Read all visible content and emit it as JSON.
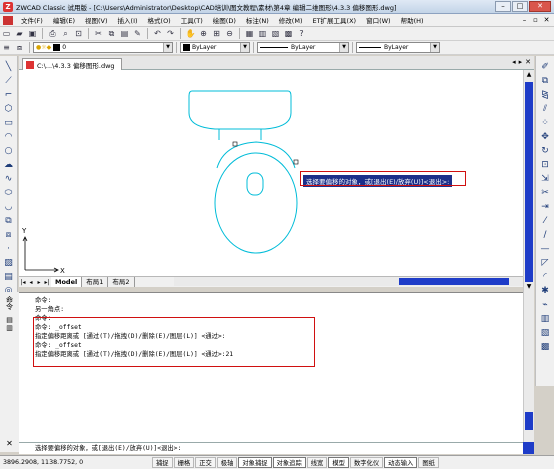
{
  "window": {
    "title": "ZWCAD Classic 试用版 - [C:\\Users\\Administrator\\Desktop\\CAD培训\\图文教程\\素材\\第4章 编辑二维图形\\4.3.3 偏移图形.dwg]",
    "app_icon_letter": "Z",
    "minimize": "–",
    "maximize": "□",
    "close": "✕"
  },
  "menu": {
    "items": [
      "文件(F)",
      "编辑(E)",
      "视图(V)",
      "插入(I)",
      "格式(O)",
      "工具(T)",
      "绘图(D)",
      "标注(N)",
      "修改(M)",
      "ET扩展工具(X)",
      "窗口(W)",
      "帮助(H)"
    ],
    "mdi_min": "–",
    "mdi_restore": "▫",
    "mdi_close": "✕"
  },
  "toolbar2": {
    "layer_value": "0",
    "color_value": "ByLayer",
    "linetype_value": "ByLayer",
    "lineweight_value": "ByLayer"
  },
  "document": {
    "tab_label": "C:\\...\\4.3.3 偏移图形.dwg",
    "nav_prev": "◂",
    "nav_next": "▸",
    "nav_close": "✕"
  },
  "canvas": {
    "tooltip": "选择要偏移的对象，或[退出(E)/放弃(U)]<退出>:",
    "ucs_x": "X",
    "ucs_y": "Y"
  },
  "layout_tabs": {
    "tabs": [
      "Model",
      "布局1",
      "布局2"
    ],
    "nav_first": "|◂",
    "nav_prev": "◂",
    "nav_next": "▸",
    "nav_last": "▸|"
  },
  "command": {
    "sidebar_label": "命令",
    "close_x": "✕",
    "lines": [
      "命令:",
      "另一角点:",
      "命令:",
      "命令: _offset",
      "指定偏移距离或 [通过(T)/拖拽(D)/删除(E)/图层(L)] <通过>:",
      "命令: _offset",
      "指定偏移距离或 [通过(T)/拖拽(D)/删除(E)/图层(L)] <通过>:21"
    ],
    "input_line": "选择要偏移的对象，或[退出(E)/放弃(U)]<退出>:"
  },
  "status": {
    "coords": "3896.2908,  1138.7752,  0",
    "buttons": [
      "捕捉",
      "栅格",
      "正交",
      "极轴",
      "对象捕捉",
      "对象追踪",
      "线宽",
      "模型",
      "数字化仪",
      "动态输入",
      "图纸"
    ]
  }
}
